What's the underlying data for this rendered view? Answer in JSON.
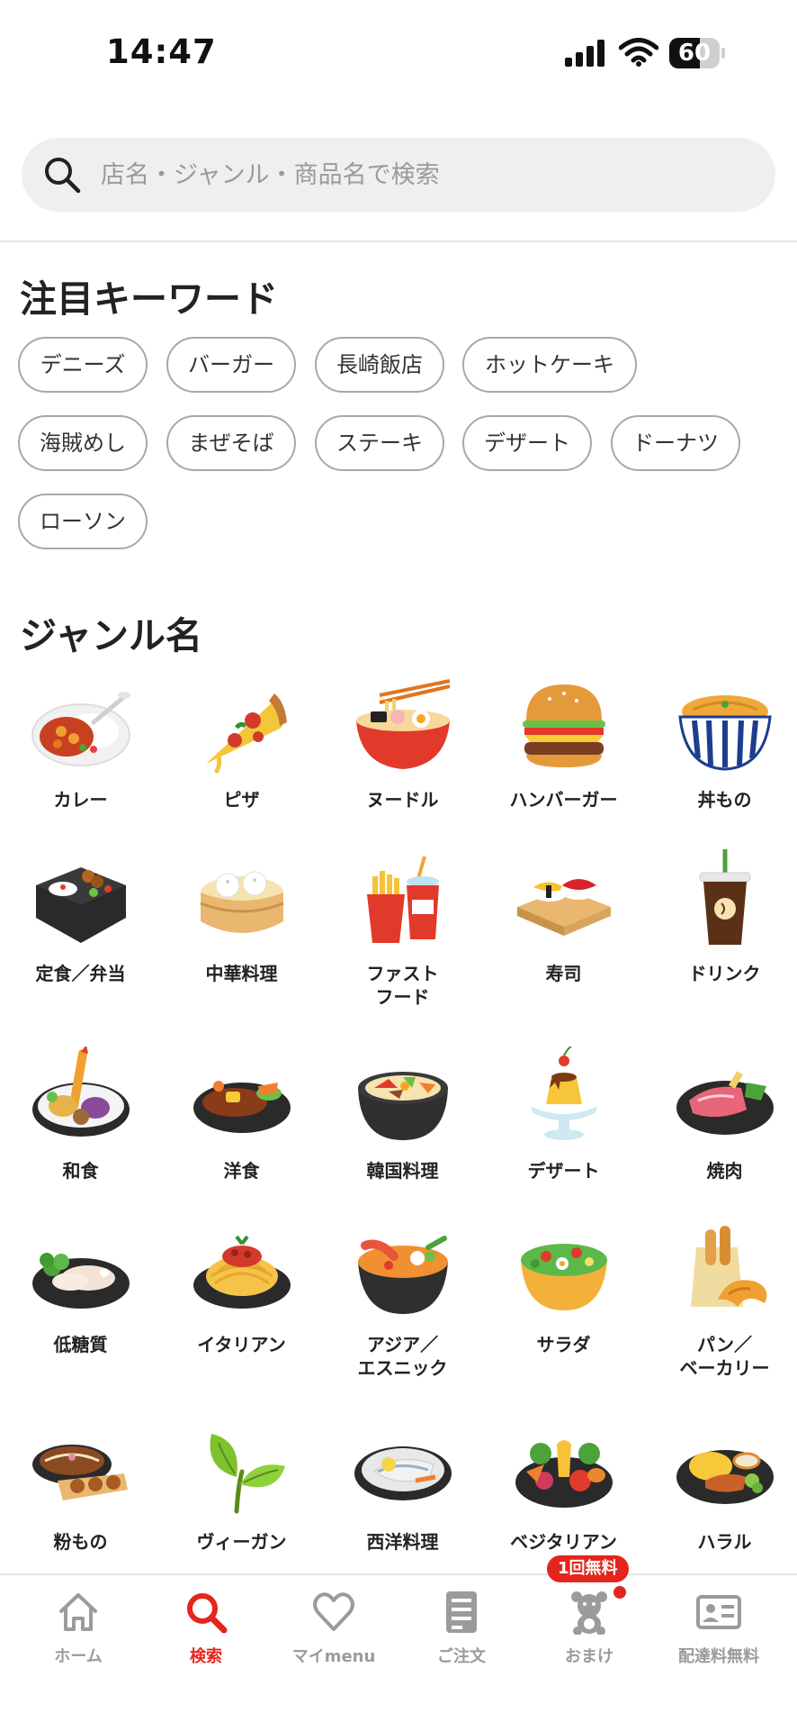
{
  "status_bar": {
    "time": "14:47",
    "battery": "60",
    "battery_level": 0.6
  },
  "search": {
    "placeholder": "店名・ジャンル・商品名で検索",
    "icon": "search-icon"
  },
  "keywords": {
    "title": "注目キーワード",
    "items": [
      "デニーズ",
      "バーガー",
      "長崎飯店",
      "ホットケーキ",
      "海賊めし",
      "まぜそば",
      "ステーキ",
      "デザート",
      "ドーナツ",
      "ローソン"
    ]
  },
  "genres": {
    "title": "ジャンル名",
    "items": [
      {
        "label": "カレー",
        "icon": "curry-icon"
      },
      {
        "label": "ピザ",
        "icon": "pizza-icon"
      },
      {
        "label": "ヌードル",
        "icon": "ramen-icon"
      },
      {
        "label": "ハンバーガー",
        "icon": "hamburger-icon"
      },
      {
        "label": "丼もの",
        "icon": "donburi-icon"
      },
      {
        "label": "定食／弁当",
        "icon": "bento-icon"
      },
      {
        "label": "中華料理",
        "icon": "dimsum-icon"
      },
      {
        "label": "ファスト\nフード",
        "icon": "fastfood-icon"
      },
      {
        "label": "寿司",
        "icon": "sushi-icon"
      },
      {
        "label": "ドリンク",
        "icon": "drink-icon"
      },
      {
        "label": "和食",
        "icon": "tempura-icon"
      },
      {
        "label": "洋食",
        "icon": "hambagu-icon"
      },
      {
        "label": "韓国料理",
        "icon": "bibimbap-icon"
      },
      {
        "label": "デザート",
        "icon": "pudding-icon"
      },
      {
        "label": "焼肉",
        "icon": "yakiniku-icon"
      },
      {
        "label": "低糖質",
        "icon": "lowcarb-icon"
      },
      {
        "label": "イタリアン",
        "icon": "pasta-icon"
      },
      {
        "label": "アジア／\nエスニック",
        "icon": "tomyum-icon"
      },
      {
        "label": "サラダ",
        "icon": "salad-icon"
      },
      {
        "label": "パン／\nベーカリー",
        "icon": "bread-icon"
      },
      {
        "label": "粉もの",
        "icon": "okonomiyaki-icon"
      },
      {
        "label": "ヴィーガン",
        "icon": "leaf-icon"
      },
      {
        "label": "西洋料理",
        "icon": "fish-dish-icon"
      },
      {
        "label": "ベジタリアン",
        "icon": "vegetables-icon"
      },
      {
        "label": "ハラル",
        "icon": "curry-plate-icon"
      }
    ]
  },
  "tab_bar": {
    "badge": "1回無料",
    "items": [
      {
        "label": "ホーム",
        "icon": "home-icon",
        "active": false
      },
      {
        "label": "検索",
        "icon": "search-icon",
        "active": true
      },
      {
        "label": "マイmenu",
        "icon": "heart-icon",
        "active": false
      },
      {
        "label": "ご注文",
        "icon": "receipt-icon",
        "active": false
      },
      {
        "label": "おまけ",
        "icon": "bear-icon",
        "active": false
      },
      {
        "label": "配達料無料",
        "icon": "id-card-icon",
        "active": false
      }
    ]
  },
  "colors": {
    "accent": "#e3261d",
    "inactive": "#9b9b9b",
    "chip_border": "#a8a8a8",
    "search_bg": "#efefef"
  }
}
